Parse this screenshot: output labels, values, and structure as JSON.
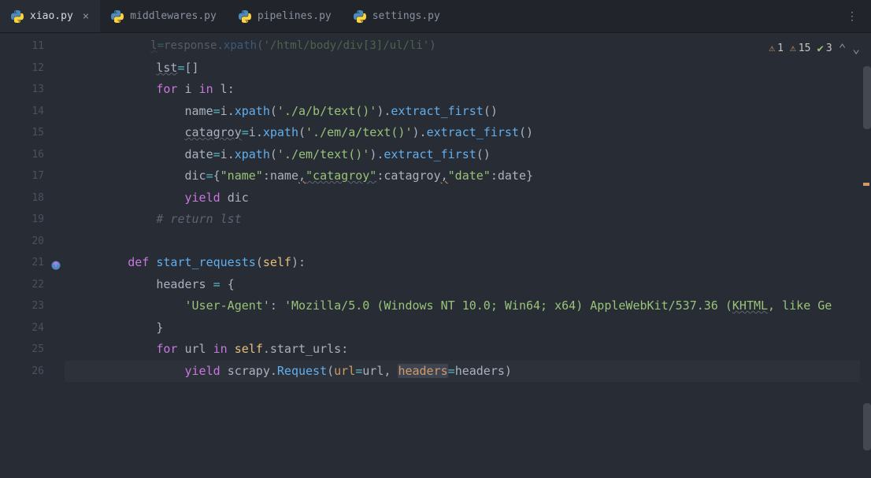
{
  "tabs": [
    {
      "label": "xiao.py",
      "active": true,
      "closable": true
    },
    {
      "label": "middlewares.py",
      "active": false,
      "closable": false
    },
    {
      "label": "pipelines.py",
      "active": false,
      "closable": false
    },
    {
      "label": "settings.py",
      "active": false,
      "closable": false
    }
  ],
  "status": {
    "warn1": "1",
    "warn2": "15",
    "check": "3"
  },
  "gutter": {
    "start": 11,
    "end": 26,
    "override_icon_line": 21
  },
  "code": {
    "ghost_line": "l=response.xpath('/html/body/div[3]/ul/li')",
    "l12": {
      "var": "lst",
      "op": "=",
      "val": "[]"
    },
    "l13": {
      "kw1": "for",
      "var": "i",
      "kw2": "in",
      "iter": "l",
      "colon": ":"
    },
    "l14": {
      "var": "name",
      "op": "=",
      "obj": "i",
      "fn": "xpath",
      "str": "'./a/b/text()'",
      "fn2": "extract_first",
      "paren": "()"
    },
    "l15": {
      "var": "catagroy",
      "op": "=",
      "obj": "i",
      "fn": "xpath",
      "str": "'./em/a/text()'",
      "fn2": "extract_first",
      "paren": "()"
    },
    "l16": {
      "var": "date",
      "op": "=",
      "obj": "i",
      "fn": "xpath",
      "str": "'./em/text()'",
      "fn2": "extract_first",
      "paren": "()"
    },
    "l17": {
      "var": "dic",
      "op": "=",
      "open": "{",
      "k1": "\"name\"",
      "v1": "name",
      "comma": ",",
      "k2": "\"catagroy\"",
      "v2": "catagroy",
      "k3": "\"date\"",
      "v3": "date",
      "close": "}"
    },
    "l18": {
      "kw": "yield",
      "var": "dic"
    },
    "l19": {
      "cmt": "# return lst"
    },
    "l21": {
      "kw": "def",
      "fn": "start_requests",
      "open": "(",
      "self": "self",
      "close": "):"
    },
    "l22": {
      "var": "headers",
      "eq": " = ",
      "open": "{"
    },
    "l23": {
      "key": "'User-Agent'",
      "colon": ": ",
      "val_a": "'Mozilla/5.0 (Windows NT 10.0; Win64; x64) AppleWebKit/537.36 (",
      "val_khtml": "KHTML",
      "val_b": ", like Ge"
    },
    "l24": {
      "close": "}"
    },
    "l25": {
      "kw1": "for",
      "var": "url",
      "kw2": "in",
      "self": "self",
      "dot": ".",
      "attr": "start_urls",
      "colon": ":"
    },
    "l26": {
      "kw": "yield",
      "mod": "scrapy",
      "dot": ".",
      "cls": "Request",
      "open": "(",
      "p1": "url",
      "eq1": "=",
      "v1": "url",
      "comma": ", ",
      "p2": "headers",
      "eq2": "=",
      "v2": "headers",
      "close": ")"
    }
  }
}
